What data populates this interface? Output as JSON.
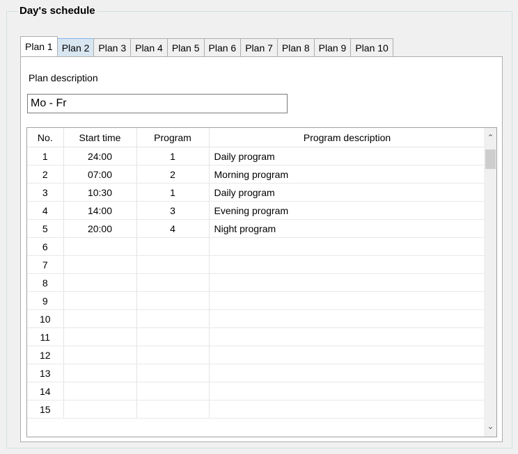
{
  "group": {
    "title": "Day's schedule"
  },
  "tabs": [
    {
      "label": "Plan 1"
    },
    {
      "label": "Plan 2"
    },
    {
      "label": "Plan 3"
    },
    {
      "label": "Plan 4"
    },
    {
      "label": "Plan 5"
    },
    {
      "label": "Plan 6"
    },
    {
      "label": "Plan 7"
    },
    {
      "label": "Plan 8"
    },
    {
      "label": "Plan 9"
    },
    {
      "label": "Plan 10"
    }
  ],
  "active_tab": "Plan 1",
  "hover_tab": "Plan 2",
  "plan": {
    "description_label": "Plan description",
    "description_value": "Mo - Fr"
  },
  "table": {
    "columns": [
      "No.",
      "Start time",
      "Program",
      "Program description"
    ],
    "rows": [
      {
        "no": "1",
        "start": "24:00",
        "program": "1",
        "desc": "Daily program"
      },
      {
        "no": "2",
        "start": "07:00",
        "program": "2",
        "desc": "Morning program"
      },
      {
        "no": "3",
        "start": "10:30",
        "program": "1",
        "desc": "Daily program"
      },
      {
        "no": "4",
        "start": "14:00",
        "program": "3",
        "desc": "Evening program"
      },
      {
        "no": "5",
        "start": "20:00",
        "program": "4",
        "desc": "Night program"
      },
      {
        "no": "6",
        "start": "",
        "program": "",
        "desc": ""
      },
      {
        "no": "7",
        "start": "",
        "program": "",
        "desc": ""
      },
      {
        "no": "8",
        "start": "",
        "program": "",
        "desc": ""
      },
      {
        "no": "9",
        "start": "",
        "program": "",
        "desc": ""
      },
      {
        "no": "10",
        "start": "",
        "program": "",
        "desc": ""
      },
      {
        "no": "11",
        "start": "",
        "program": "",
        "desc": ""
      },
      {
        "no": "12",
        "start": "",
        "program": "",
        "desc": ""
      },
      {
        "no": "13",
        "start": "",
        "program": "",
        "desc": ""
      },
      {
        "no": "14",
        "start": "",
        "program": "",
        "desc": ""
      },
      {
        "no": "15",
        "start": "",
        "program": "",
        "desc": ""
      }
    ]
  },
  "icons": {
    "scroll_up": "chevron-up-icon",
    "scroll_down": "chevron-down-icon"
  }
}
